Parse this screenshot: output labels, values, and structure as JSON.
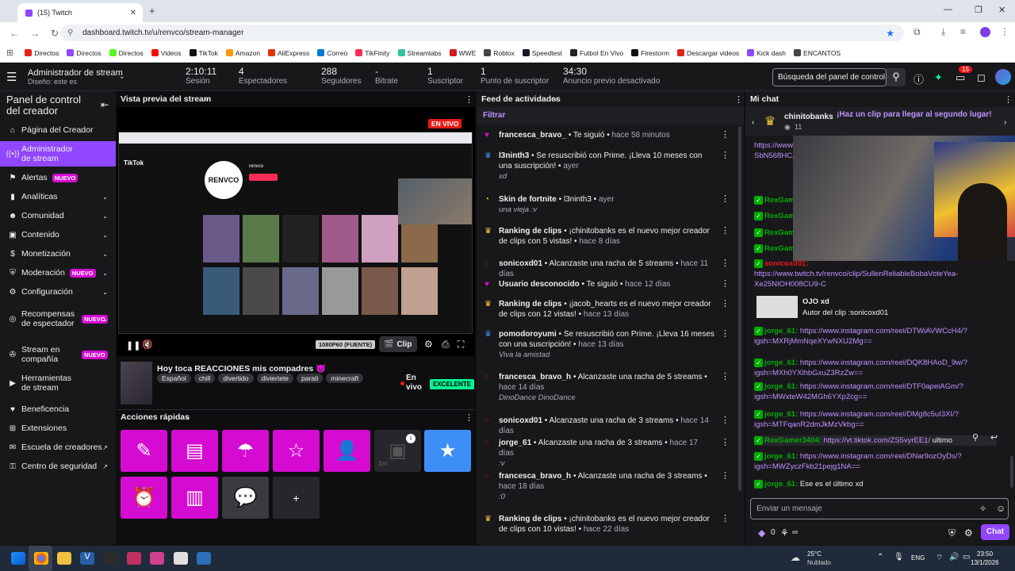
{
  "browser": {
    "tab_title": "(15) Twitch",
    "url": "dashboard.twitch.tv/u/renvco/stream-manager",
    "bookmarks": [
      {
        "label": "Directos",
        "color": "#e62117"
      },
      {
        "label": "Directos",
        "color": "#9146ff"
      },
      {
        "label": "Directos",
        "color": "#53fc18"
      },
      {
        "label": "Videos",
        "color": "#ff0000"
      },
      {
        "label": "TikTok",
        "color": "#111111"
      },
      {
        "label": "Amazon",
        "color": "#ff9900"
      },
      {
        "label": "AliExpress",
        "color": "#e62e04"
      },
      {
        "label": "Correo",
        "color": "#0078d4"
      },
      {
        "label": "TikFinity",
        "color": "#fe2c55"
      },
      {
        "label": "Streamlabs",
        "color": "#31c3a2"
      },
      {
        "label": "WWE",
        "color": "#d71920"
      },
      {
        "label": "Roblox",
        "color": "#444444"
      },
      {
        "label": "Speedtest",
        "color": "#141526"
      },
      {
        "label": "Futbol En Vivo",
        "color": "#222222"
      },
      {
        "label": "Firestorm",
        "color": "#111111"
      },
      {
        "label": "Descargar videos",
        "color": "#e62117"
      },
      {
        "label": "Kick dash",
        "color": "#9146ff"
      },
      {
        "label": "ENCANTOS",
        "color": "#444444"
      }
    ]
  },
  "topbar": {
    "title": "Administrador de stream",
    "subtitle": "Diseño: este es",
    "stats": [
      {
        "value": "2:10:11",
        "label": "Sesión"
      },
      {
        "value": "4",
        "label": "Espectadores"
      },
      {
        "value": "288",
        "label": "Seguidores"
      },
      {
        "value": "-",
        "label": "Bitrate"
      },
      {
        "value": "1",
        "label": "Suscriptor"
      },
      {
        "value": "1",
        "label": "Punto de suscriptor"
      },
      {
        "value": "34:30",
        "label": "Anuncio previo desactivado"
      }
    ],
    "search_placeholder": "Búsqueda del panel de control",
    "notif_count": "15"
  },
  "sidebar": {
    "title": "Panel de control del creador",
    "items": [
      {
        "label": "Página del Creador"
      },
      {
        "label": "Administrador de stream"
      },
      {
        "label": "Alertas",
        "badge": "NUEVO"
      },
      {
        "label": "Analíticas"
      },
      {
        "label": "Comunidad"
      },
      {
        "label": "Contenido"
      },
      {
        "label": "Monetización"
      },
      {
        "label": "Moderación",
        "badge": "NUEVO"
      },
      {
        "label": "Configuración"
      },
      {
        "label": "Recompensas de espectador",
        "badge": "NUEVO"
      },
      {
        "label": "Stream en compañía",
        "badge": "NUEVO"
      },
      {
        "label": "Herramientas de stream"
      },
      {
        "label": "Beneficencia"
      },
      {
        "label": "Extensiones"
      },
      {
        "label": "Escuela de creadores"
      },
      {
        "label": "Centro de seguridad"
      }
    ]
  },
  "preview": {
    "header": "Vista previa del stream",
    "live_badge": "EN VIVO",
    "quality": "1080P60 (FUENTE)",
    "clip_label": "Clip",
    "screen_profile": "renvco",
    "stream_title": "Hoy toca REACCIONES mis compadres",
    "tags": [
      "Español",
      "chill",
      "divertido",
      "diviertete",
      "parati",
      "minecraft"
    ],
    "status": "En vivo",
    "health": "EXCELENTE"
  },
  "quick_actions": {
    "header": "Acciones rápidas",
    "cooldown": "1m"
  },
  "activity": {
    "header": "Feed de actividades",
    "filter": "Filtrar",
    "items": [
      {
        "icon": "heart-icon",
        "color": "#d50bd2",
        "user": "francesca_bravo_",
        "action": "Te siguió",
        "time": "hace 58 minutos",
        "note": ""
      },
      {
        "icon": "crown-icon",
        "color": "#3f8cff",
        "user": "l3ninth3",
        "action": "Se resuscribió con Prime. ¡Lleva 10 meses con una suscripción!",
        "time": "ayer",
        "note": "xd"
      },
      {
        "icon": "clock-icon",
        "color": "#ffca3a",
        "user": "Skin de fortnite",
        "action": "l3ninth3",
        "time": "ayer",
        "note": "una vieja :v"
      },
      {
        "icon": "crown-icon",
        "color": "#ffca3a",
        "user": "Ranking de clips",
        "action": "¡chinitobanks es el nuevo mejor creador de clips con 5 vistas!",
        "time": "hace 8 días",
        "note": ""
      },
      {
        "icon": "flame-icon",
        "color": "#e91916",
        "user": "sonicoxd01",
        "action": "Alcanzaste una racha de 5 streams",
        "time": "hace 11 días",
        "note": ""
      },
      {
        "icon": "heart-icon",
        "color": "#d50bd2",
        "user": "Usuario desconocido",
        "action": "Te siguió",
        "time": "hace 12 días",
        "note": ""
      },
      {
        "icon": "crown-icon",
        "color": "#ffca3a",
        "user": "Ranking de clips",
        "action": "¡jacob_hearts es el nuevo mejor creador de clips con 12 vistas!",
        "time": "hace 13 días",
        "note": ""
      },
      {
        "icon": "crown-icon",
        "color": "#3f8cff",
        "user": "pomodoroyumi",
        "action": "Se resuscribió con Prime. ¡Lleva 16 meses con una suscripción!",
        "time": "hace 13 días",
        "note": "Viva la amistad"
      },
      {
        "icon": "flame-icon",
        "color": "#e91916",
        "user": "francesca_bravo_h",
        "action": "Alcanzaste una racha de 5 streams",
        "time": "hace 14 días",
        "note": "DinoDance DinoDance"
      },
      {
        "icon": "flame-icon",
        "color": "#e91916",
        "user": "sonicoxd01",
        "action": "Alcanzaste una racha de 3 streams",
        "time": "hace 14 días",
        "note": ""
      },
      {
        "icon": "flame-icon",
        "color": "#e91916",
        "user": "jorge_61",
        "action": "Alcanzaste una racha de 3 streams",
        "time": "hace 17 días",
        "note": ":v"
      },
      {
        "icon": "flame-icon",
        "color": "#e91916",
        "user": "francesca_bravo_h",
        "action": "Alcanzaste una racha de 3 streams",
        "time": "hace 18 días",
        "note": ":0"
      },
      {
        "icon": "crown-icon",
        "color": "#ffca3a",
        "user": "Ranking de clips",
        "action": "¡chinitobanks es el nuevo mejor creador de clips con 10 vistas!",
        "time": "hace 22 días",
        "note": ""
      }
    ]
  },
  "chat": {
    "header": "Mi chat",
    "pinned_user": "chinitobanks",
    "pinned_count": "11",
    "pinned_text": "¡Haz un clip para llegar al segundo lugar!",
    "messages": [
      {
        "user": "",
        "text": "https://www...",
        "ucolor": "#bf94ff",
        "link": true
      },
      {
        "user": "",
        "text": "SbN568HC...",
        "ucolor": "#bf94ff",
        "link": true
      },
      {
        "user": "RexGam",
        "text": "",
        "ucolor": "#00ad03",
        "link": false
      },
      {
        "user": "RexGam",
        "text": "",
        "ucolor": "#00ad03",
        "link": false
      },
      {
        "user": "RexGam",
        "text": "",
        "ucolor": "#00ad03",
        "link": false
      },
      {
        "user": "RexGam",
        "text": "",
        "ucolor": "#00ad03",
        "link": false
      },
      {
        "user": "sonicoxd01:",
        "text": "https://www.twitch.tv/renvco/clip/SullenReliableBobaVoteYea-Xe25NIOH008CU9-C",
        "ucolor": "#e91916",
        "link": true
      },
      {
        "user": "jorge_61:",
        "text": "https://www.instagram.com/reel/DTWiAVWCcH4/?igsh=MXRjMmNqeXYwNXU2Mg==",
        "ucolor": "#00ad03",
        "link": true
      },
      {
        "user": "jorge_61:",
        "text": "https://www.instagram.com/reel/DQK8HAoD_9w/?igsh=MXh0YXlhbGxuZ3RzZw==",
        "ucolor": "#00ad03",
        "link": true
      },
      {
        "user": "jorge_61:",
        "text": "https://www.instagram.com/reel/DTF0apeiAGm/?igsh=MWxteW42MGh6YXp2cg==",
        "ucolor": "#00ad03",
        "link": true
      },
      {
        "user": "jorge_61:",
        "text": "https://www.instagram.com/reel/DMg8c5uI3XI/?igsh=MTFqanR2dmJkMzVkbg==",
        "ucolor": "#00ad03",
        "link": true
      },
      {
        "user": "RexGamer3404:",
        "text": "https://vt.tiktok.com/ZS5vyrEE1/",
        "extra": "ultimo",
        "ucolor": "#00ad03",
        "link": true
      },
      {
        "user": "jorge_61:",
        "text": "https://www.instagram.com/reel/DNar9ozOyDs/?igsh=MWZyczFkb21pejg1NA==",
        "ucolor": "#00ad03",
        "link": true
      },
      {
        "user": "jorge_61:",
        "text": "Ese es el último xd",
        "ucolor": "#00ad03",
        "link": false
      }
    ],
    "clip_card_title": "OJO xd",
    "clip_card_author": "Autor del clip :sonicoxd01",
    "input_placeholder": "Enviar un mensaje",
    "points": "0",
    "infinite": "∞",
    "send_label": "Chat"
  },
  "taskbar": {
    "temp": "25°C",
    "weather": "Nublado",
    "lang": "ENG",
    "time": "23:50",
    "date": "13/1/2026"
  }
}
